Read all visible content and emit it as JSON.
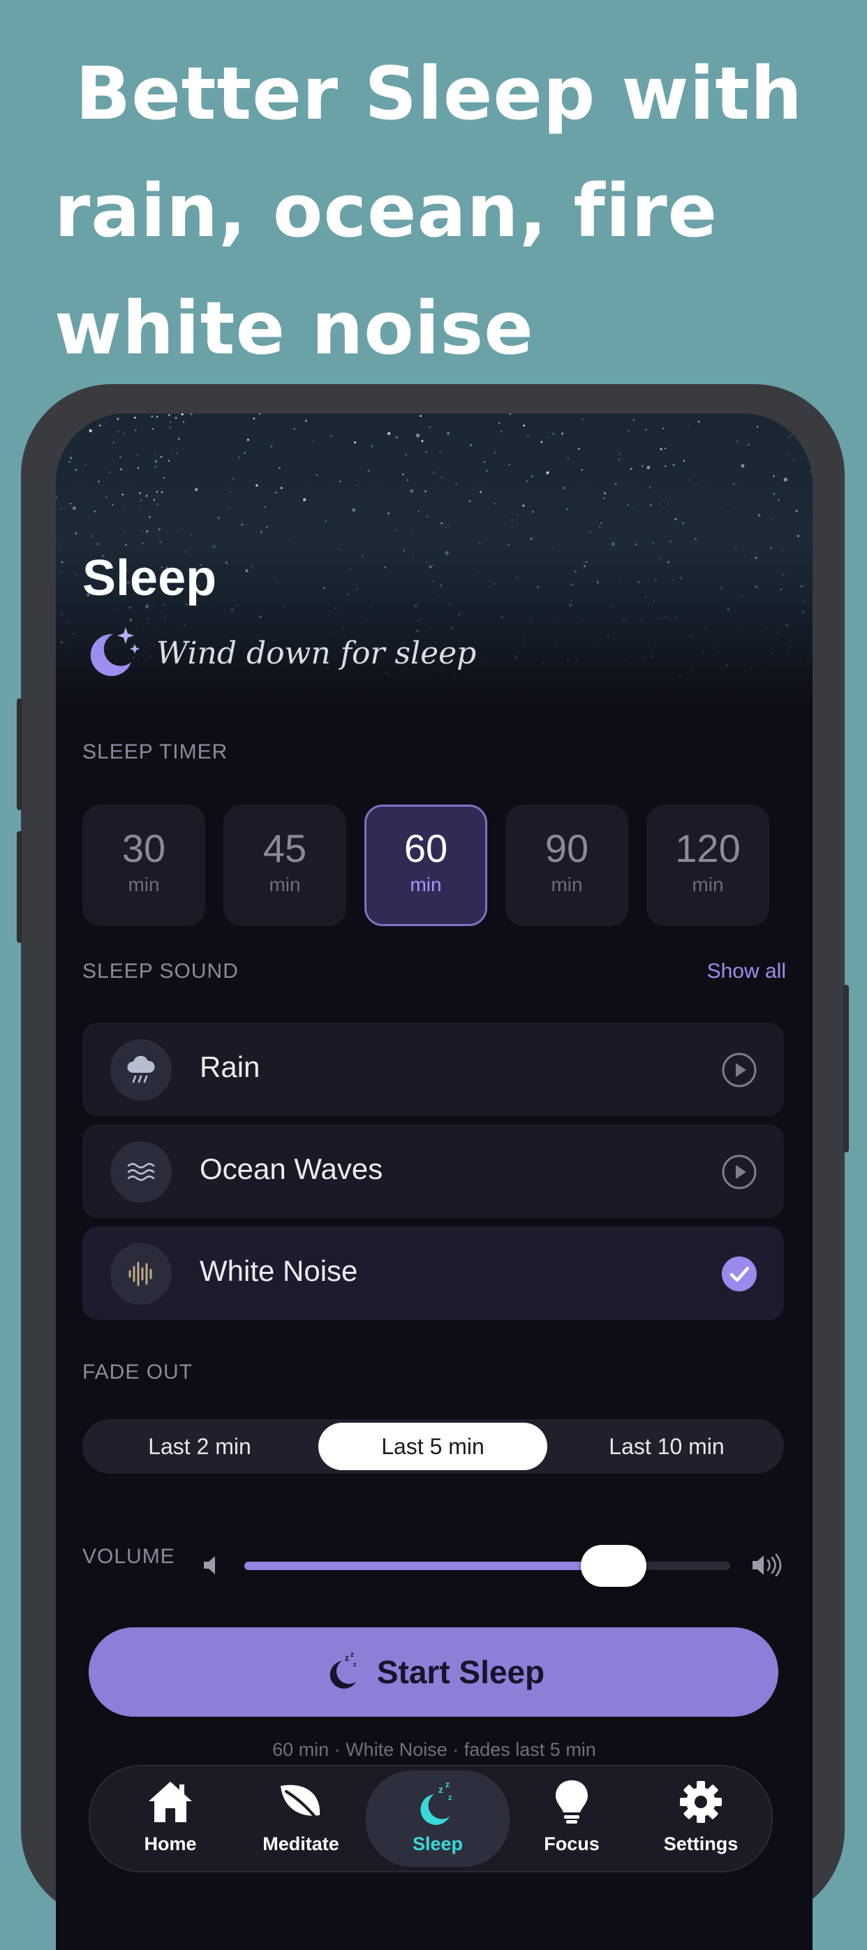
{
  "promo": {
    "line1": "Better Sleep  with",
    "line2": "rain, ocean, fire",
    "line3": "white noise"
  },
  "screen": {
    "title": "Sleep",
    "subtitle": "Wind down for sleep",
    "timer_section": "SLEEP TIMER",
    "timers": [
      {
        "value": "30",
        "unit": "min"
      },
      {
        "value": "45",
        "unit": "min"
      },
      {
        "value": "60",
        "unit": "min",
        "selected": true
      },
      {
        "value": "90",
        "unit": "min"
      },
      {
        "value": "120",
        "unit": "min"
      }
    ],
    "sound_section": "SLEEP SOUND",
    "show_all": "Show all",
    "sounds": [
      {
        "name": "Rain",
        "icon": "rain-cloud-icon",
        "action": "play-icon"
      },
      {
        "name": "Ocean Waves",
        "icon": "waves-icon",
        "action": "play-icon"
      },
      {
        "name": "White Noise",
        "icon": "soundwave-icon",
        "action": "check-icon",
        "selected": true
      }
    ],
    "fade_section": "FADE OUT",
    "fade_options": [
      "Last 2 min",
      "Last 5 min",
      "Last 10 min"
    ],
    "fade_selected": "Last 5 min",
    "volume_label": "VOLUME",
    "volume_level": 0.76,
    "start_button": "Start Sleep",
    "summary": "60 min · White Noise · fades last 5 min",
    "tabs": [
      {
        "label": "Home",
        "icon": "home-icon"
      },
      {
        "label": "Meditate",
        "icon": "leaf-icon"
      },
      {
        "label": "Sleep",
        "icon": "moon-zzz-icon",
        "selected": true
      },
      {
        "label": "Focus",
        "icon": "lightbulb-icon"
      },
      {
        "label": "Settings",
        "icon": "gear-icon"
      }
    ]
  },
  "colors": {
    "background": "#6aa2a8",
    "accent": "#8c7fd8",
    "active_tab": "#39d9d9"
  }
}
